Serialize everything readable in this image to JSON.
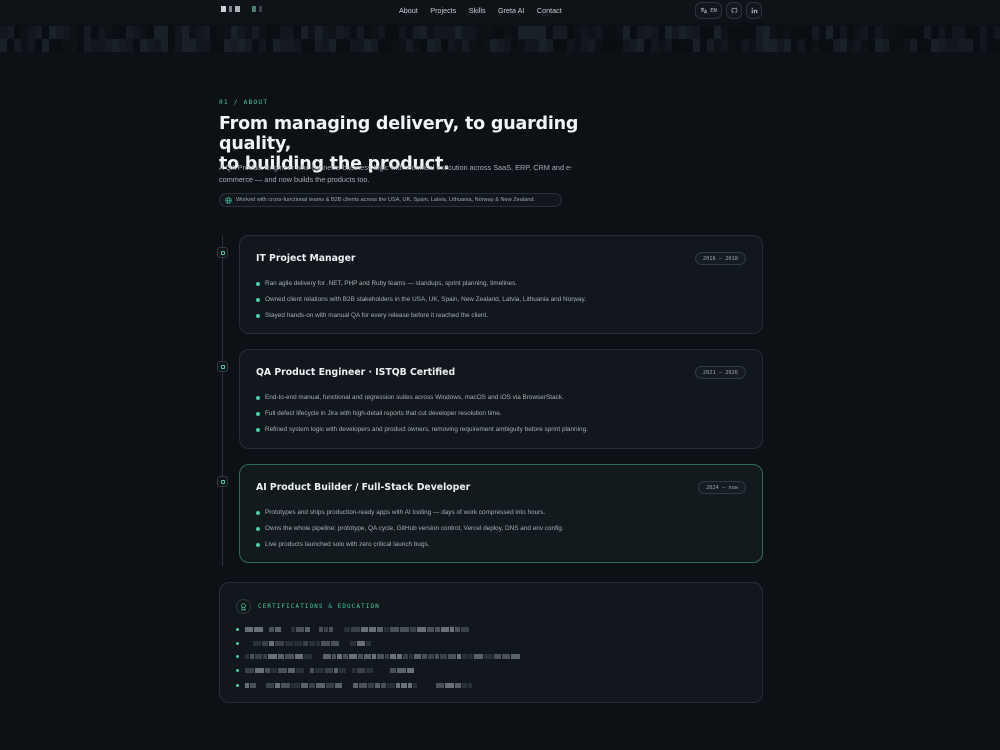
{
  "nav": {
    "links": [
      "About",
      "Projects",
      "Skills",
      "Greta AI",
      "Contact"
    ],
    "lang_label": "EN"
  },
  "about": {
    "eyebrow": "01 / ABOUT",
    "headline_line1": "From managing delivery, to guarding quality,",
    "headline_line2": "to building the product.",
    "lede": "A QA Product Engineer who connects business logic with technical execution across SaaS, ERP, CRM and e-commerce — and now builds the products too.",
    "chip": "Worked with cross-functional teams & B2B clients across the USA, UK, Spain, Latvia, Lithuania, Norway & New Zealand."
  },
  "timeline": [
    {
      "title": "IT Project Manager",
      "period": "2016 — 2018",
      "bullets": [
        "Ran agile delivery for .NET, PHP and Ruby teams — standups, sprint planning, timelines.",
        "Owned client relations with B2B stakeholders in the USA, UK, Spain, New Zealand, Latvia, Lithuania and Norway.",
        "Stayed hands-on with manual QA for every release before it reached the client."
      ]
    },
    {
      "title": "QA Product Engineer · ISTQB Certified",
      "period": "2021 — 2026",
      "bullets": [
        "End-to-end manual, functional and regression suites across Windows, macOS and iOS via BrowserStack.",
        "Full defect lifecycle in Jira with high-detail reports that cut developer resolution time.",
        "Refined system logic with developers and product owners, removing requirement ambiguity before sprint planning."
      ]
    },
    {
      "title": "AI Product Builder / Full-Stack Developer",
      "period": "2024 — now",
      "bullets": [
        "Prototypes and ships production-ready apps with AI tooling — days of work compressed into hours.",
        "Owns the whole pipeline: prototype, QA cycle, GitHub version control, Vercel deploy, DNS and env config.",
        "Live products launched solo with zero critical launch bugs."
      ]
    }
  ],
  "certifications": {
    "title": "CERTIFICATIONS & EDUCATION"
  },
  "colors": {
    "accent": "#3fcf9f",
    "background": "#0d1116",
    "card": "#12171d"
  }
}
